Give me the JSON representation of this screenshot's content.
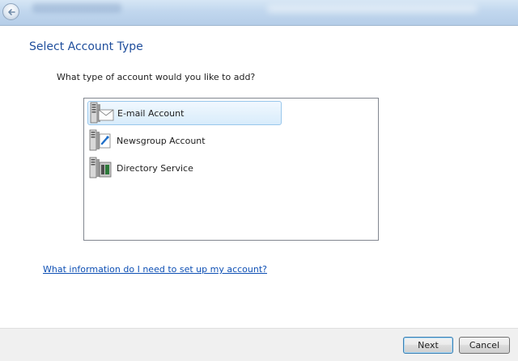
{
  "window": {
    "back_icon": "back-arrow-icon"
  },
  "page": {
    "title": "Select Account Type",
    "question": "What type of account would you like to add?"
  },
  "account_types": [
    {
      "label": "E-mail Account",
      "icon": "email-server-icon",
      "selected": true
    },
    {
      "label": "Newsgroup Account",
      "icon": "newsgroup-server-icon",
      "selected": false
    },
    {
      "label": "Directory Service",
      "icon": "directory-server-icon",
      "selected": false
    }
  ],
  "help_link": "What information do I need to set up my account?",
  "buttons": {
    "next": "Next",
    "cancel": "Cancel"
  },
  "colors": {
    "title": "#1f4e9c",
    "link": "#0d4fb4",
    "selection": "#d8ecfb"
  }
}
